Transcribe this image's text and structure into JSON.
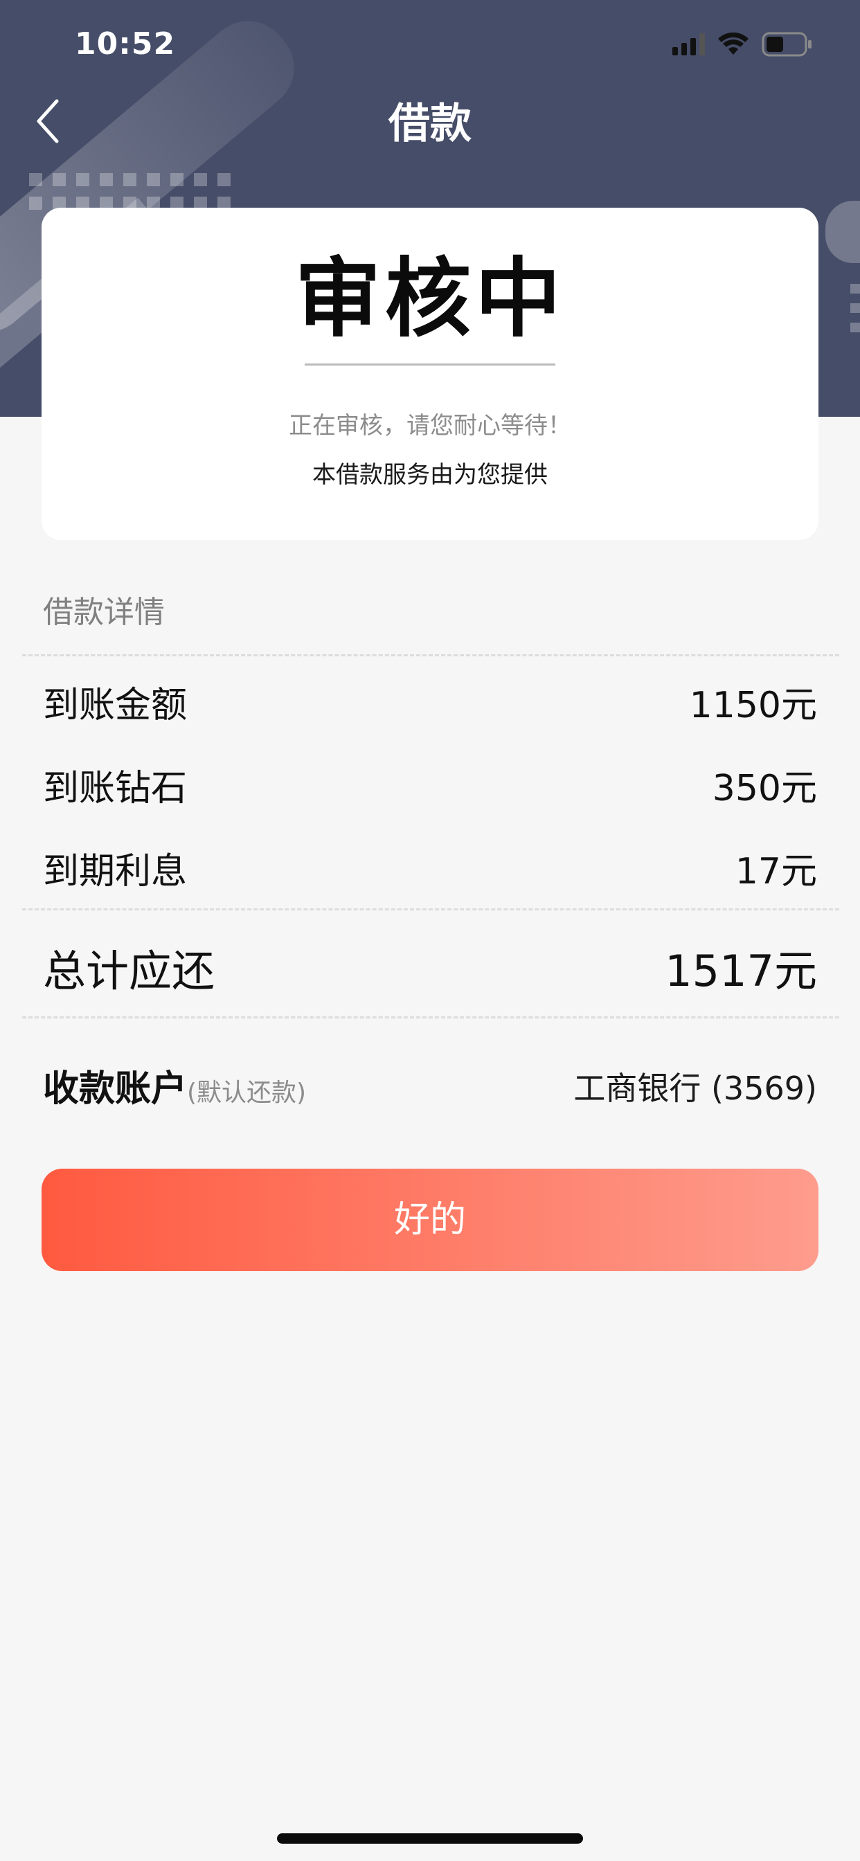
{
  "status_bar": {
    "time": "10:52"
  },
  "nav": {
    "title": "借款",
    "back_icon": "chevron-left-icon"
  },
  "status_card": {
    "status": "审核中",
    "note": "正在审核，请您耐心等待！",
    "provider": "本借款服务由为您提供"
  },
  "details": {
    "title": "借款详情",
    "rows": [
      {
        "label": "到账金额",
        "value": "1150元"
      },
      {
        "label": "到账钻石",
        "value": "350元"
      },
      {
        "label": "到期利息",
        "value": "17元"
      }
    ],
    "total": {
      "label": "总计应还",
      "value": "1517元"
    },
    "account": {
      "label": "收款账户",
      "hint": "(默认还款)",
      "value": "工商银行 (3569)"
    }
  },
  "action": {
    "ok_label": "好的"
  },
  "colors": {
    "header_bg": "#464d68",
    "button_start": "#ff5a40",
    "button_end": "#fe9c8d",
    "page_bg": "#f6f6f6"
  }
}
